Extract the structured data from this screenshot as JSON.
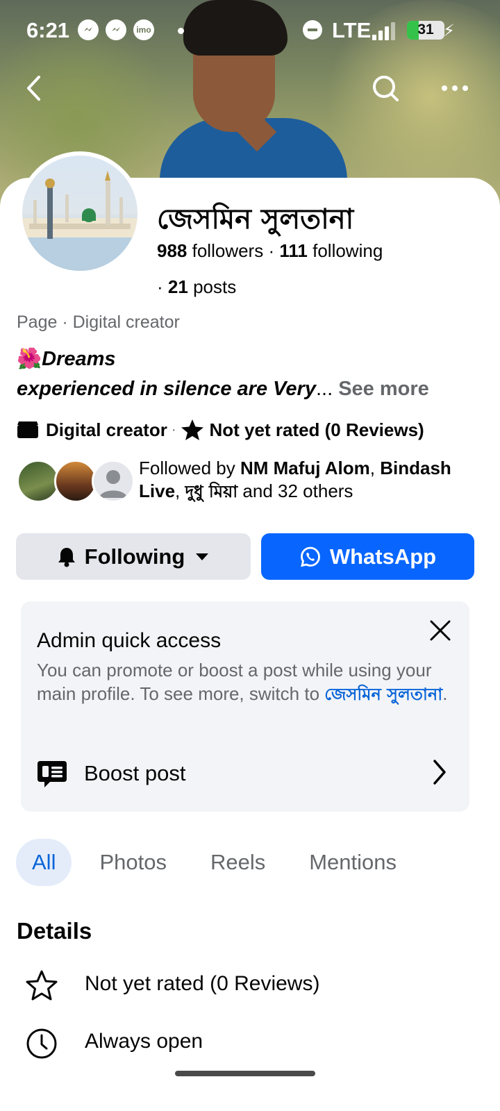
{
  "status_bar": {
    "time": "6:21",
    "network": "LTE",
    "battery": "31",
    "battery_level": 0.31,
    "notification_icons": [
      "messenger-icon",
      "messenger-icon",
      "imo-icon"
    ]
  },
  "profile": {
    "name": "জেসমিন সুলতানা",
    "followers_count": "988",
    "followers_label": "followers",
    "separator": "·",
    "following_count": "111",
    "following_label": "following",
    "posts_count": "21",
    "posts_label": "posts",
    "category": "Page · Digital creator",
    "bio_line1": "Dreams",
    "bio_line2": "experienced  in  silence are Very",
    "bio_ellipsis": "...",
    "see_more": "See more",
    "meta_category": "Digital creator",
    "meta_rating": "Not yet rated (0 Reviews)"
  },
  "followed_by": {
    "prefix": "Followed by ",
    "name1": "NM Mafuj Alom",
    "comma1": ", ",
    "name2": "Bindash Live",
    "comma2": ", ",
    "name3": "দুধু মিয়া",
    "suffix": " and 32 others"
  },
  "actions": {
    "following_label": "Following",
    "whatsapp_label": "WhatsApp"
  },
  "admin_card": {
    "title": "Admin quick access",
    "description": "You can promote or boost a post while using your main profile. To see more, switch to ",
    "switch_link": "জেসমিন সুলতানা",
    "description_end": ".",
    "boost_label": "Boost post"
  },
  "tabs": [
    {
      "label": "All",
      "active": true
    },
    {
      "label": "Photos",
      "active": false
    },
    {
      "label": "Reels",
      "active": false
    },
    {
      "label": "Mentions",
      "active": false
    }
  ],
  "details": {
    "heading": "Details",
    "items": [
      {
        "label": "Not yet rated (0 Reviews)",
        "icon": "star-outline-icon"
      },
      {
        "label": "Always open",
        "icon": "clock-icon"
      }
    ]
  },
  "colors": {
    "primary": "#0866ff",
    "link": "#0864d8",
    "secondary_text": "#65676b",
    "button_gray": "#e4e6eb",
    "card_bg": "#f3f4f7",
    "active_tab_bg": "#e4ecfa"
  }
}
